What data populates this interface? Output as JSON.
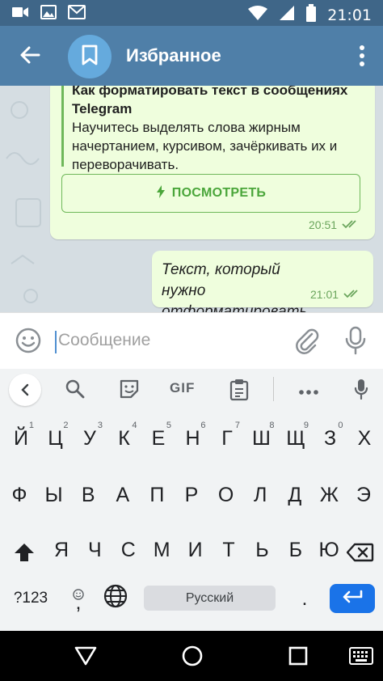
{
  "status_bar": {
    "time": "21:01",
    "left_icons": [
      "video-icon",
      "image-icon",
      "gmail-icon"
    ],
    "right_icons": [
      "wifi-icon",
      "signal-icon",
      "battery-icon"
    ]
  },
  "header": {
    "title": "Избранное",
    "back_icon": "arrow-left-icon",
    "avatar_icon": "bookmark-icon",
    "menu_icon": "more-vertical-icon"
  },
  "messages": {
    "incoming": {
      "preview_title": "Как форматировать текст в сообщениях Telegram",
      "preview_description": "Научитесь выделять слова жирным начертанием, курсивом, зачёркивать их и переворачивать.",
      "view_button": "ПОСМОТРЕТЬ",
      "time": "20:51"
    },
    "outgoing": {
      "text": "Текст, который нужно отформатировать",
      "time": "21:01"
    }
  },
  "input": {
    "placeholder": "Сообщение"
  },
  "keyboard": {
    "toolbar": {
      "gif_label": "GIF"
    },
    "row1": [
      {
        "label": "Й",
        "hint": "1"
      },
      {
        "label": "Ц",
        "hint": "2"
      },
      {
        "label": "У",
        "hint": "3"
      },
      {
        "label": "К",
        "hint": "4"
      },
      {
        "label": "Е",
        "hint": "5"
      },
      {
        "label": "Н",
        "hint": "6"
      },
      {
        "label": "Г",
        "hint": "7"
      },
      {
        "label": "Ш",
        "hint": "8"
      },
      {
        "label": "Щ",
        "hint": "9"
      },
      {
        "label": "З",
        "hint": "0"
      },
      {
        "label": "Х",
        "hint": ""
      }
    ],
    "row2": [
      "Ф",
      "Ы",
      "В",
      "А",
      "П",
      "Р",
      "О",
      "Л",
      "Д",
      "Ж",
      "Э"
    ],
    "row3": [
      "Я",
      "Ч",
      "С",
      "М",
      "И",
      "Т",
      "Ь",
      "Б",
      "Ю"
    ],
    "symbols_key": "?123",
    "comma_key": ",",
    "period_key": ".",
    "space_label": "Русский"
  },
  "colors": {
    "header": "#4f7fa8",
    "status_bar": "#3f6688",
    "bubble": "#effedd",
    "accent_green": "#4aa63a",
    "enter_key": "#1a73e8"
  }
}
